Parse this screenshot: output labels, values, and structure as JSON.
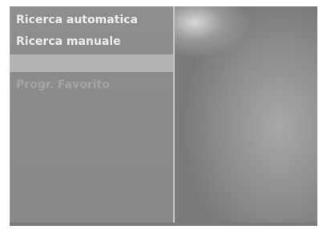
{
  "menu": {
    "items": [
      {
        "label": "Ricerca automatica",
        "state": "normal"
      },
      {
        "label": "Ricerca manuale",
        "state": "normal"
      },
      {
        "label": "",
        "state": "selected"
      },
      {
        "label": "Progr. Favorito",
        "state": "disabled"
      }
    ]
  },
  "colors": {
    "panel_bg": "#8c8c8c",
    "text_normal": "#ececec",
    "text_disabled": "#a4a4a4",
    "selection_bar": "#b4b4b4",
    "divider": "#c4c4c4"
  }
}
